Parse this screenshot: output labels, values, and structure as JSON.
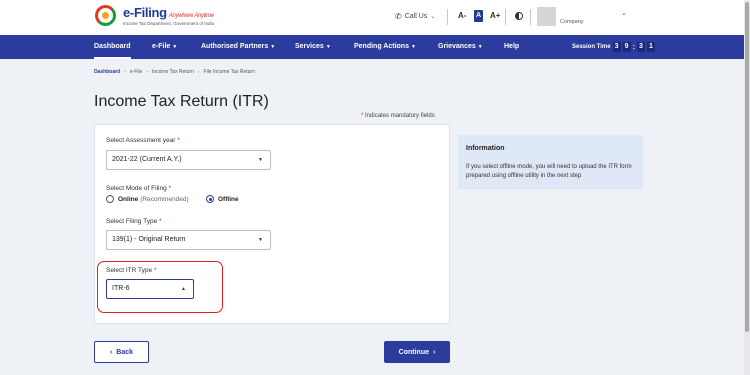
{
  "header": {
    "logo_title": "e-Filing",
    "logo_tagline": "Anywhere Anytime",
    "logo_subtitle": "Income Tax Department, Government of India",
    "call_us": "Call Us",
    "font_small": "A-",
    "font_normal": "A",
    "font_large": "A+",
    "company": "Company"
  },
  "nav": {
    "items": [
      {
        "label": "Dashboard"
      },
      {
        "label": "e-File"
      },
      {
        "label": "Authorised Partners"
      },
      {
        "label": "Services"
      },
      {
        "label": "Pending Actions"
      },
      {
        "label": "Grievances"
      },
      {
        "label": "Help"
      }
    ],
    "session_label": "Session Time",
    "session_digits": [
      "3",
      "9",
      "3",
      "1"
    ],
    "session_colon": ":"
  },
  "breadcrumb": [
    "Dashboard",
    "e-File",
    "Income Tax Return",
    "File Income Tax Return"
  ],
  "page": {
    "title": "Income Tax Return (ITR)",
    "mandatory_note": "Indicates mandatory fields",
    "star": "*"
  },
  "form": {
    "assessment_year_label": "Select Assessment year",
    "assessment_year_value": "2021-22  (Current A.Y.)",
    "mode_label": "Select Mode of Filing",
    "mode_online": "Online",
    "mode_online_note": "(Recommended)",
    "mode_offline": "Offline",
    "mode_selected": "Offline",
    "filing_type_label": "Select Filing Type",
    "filing_type_value": "139(1) - Original Return",
    "itr_type_label": "Select ITR Type",
    "itr_type_value": "ITR-6"
  },
  "info": {
    "title": "Information",
    "text": "If you select offline mode, you will need to upload the ITR form prepared using offline utility in the next step"
  },
  "buttons": {
    "back": "Back",
    "continue": "Continue"
  },
  "colors": {
    "primary": "#2b3c9e",
    "highlight": "#e02020",
    "info_bg": "#dfe8f6"
  }
}
